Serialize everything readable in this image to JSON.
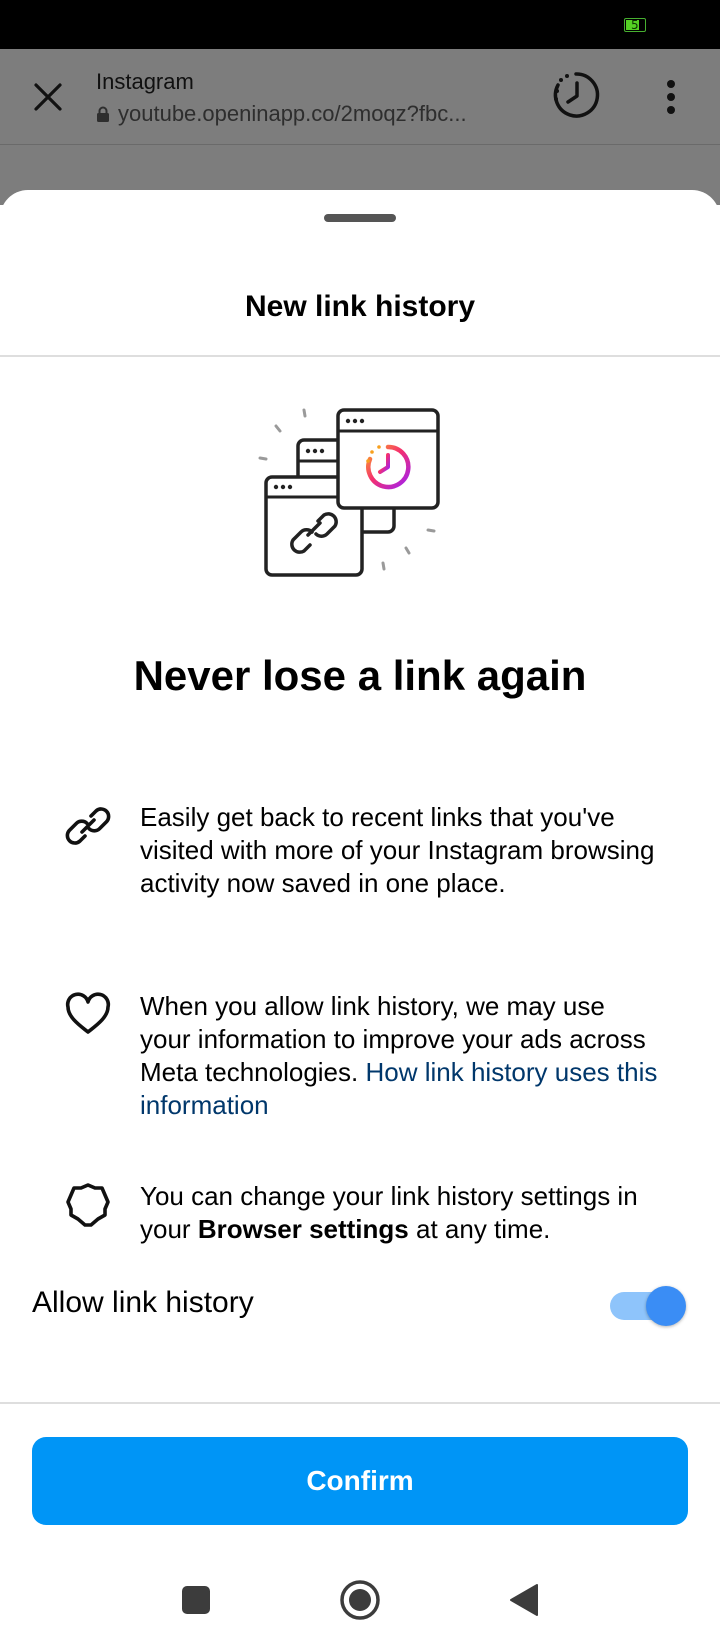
{
  "status_bar": {
    "battery_level": "5"
  },
  "browser": {
    "title": "Instagram",
    "url": "youtube.openinapp.co/2moqz?fbc..."
  },
  "sheet": {
    "title": "New link history",
    "headline": "Never lose a link again",
    "items": [
      {
        "icon": "link-icon",
        "text": "Easily get back to recent links that you've visited with more of your Instagram browsing activity now saved in one place."
      },
      {
        "icon": "heart-icon",
        "text": "When you allow link history, we may use your information to improve your ads across Meta technologies.",
        "link": "How link history uses this information"
      },
      {
        "icon": "gear-icon",
        "text_before": "You can change your link history settings in your",
        "bold": "Browser settings",
        "text_after": "at any time."
      }
    ],
    "toggle": {
      "label": "Allow link history",
      "on": true
    },
    "confirm_label": "Confirm"
  },
  "colors": {
    "primary": "#0095f6",
    "link": "#00376b",
    "toggle_knob": "#3a8df5",
    "toggle_track": "#8ec4fb",
    "overlay": "#7d7d7d"
  },
  "nav": {
    "icons": [
      "recents-icon",
      "home-icon",
      "back-icon"
    ]
  }
}
